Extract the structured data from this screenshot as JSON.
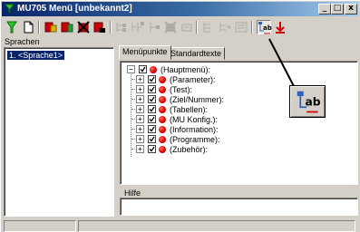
{
  "window": {
    "title": "MU705 Menü [unbekannt2]",
    "minimize": "_",
    "maximize": "□",
    "close": "x"
  },
  "toolbar": {
    "icons": [
      "filter-green-icon",
      "new-document-icon",
      "add-entry-icon",
      "edit-entry-icon",
      "delete-entry-icon",
      "rename-entry-icon",
      "tree-op-1-icon",
      "tree-op-2-icon",
      "tree-op-3-icon",
      "tree-op-4-icon",
      "tree-op-5-icon",
      "tree-op-6-icon",
      "tree-op-7-icon",
      "tree-op-8-icon",
      "rename-text-icon",
      "move-down-red-icon"
    ]
  },
  "languages": {
    "label": "Sprachen",
    "items": [
      "1. <Sprache1>"
    ]
  },
  "tabs": [
    {
      "label": "Menüpunkte",
      "active": true
    },
    {
      "label": "Standardtexte",
      "active": false
    }
  ],
  "tree": {
    "root": "(Hauptmenü):",
    "children": [
      "(Parameter):",
      "(Test):",
      "(Ziel/Nummer):",
      "(Tabellen):",
      "(MU Konfig.):",
      "(Information):",
      "(Programme):",
      "(Zubehör):"
    ]
  },
  "help": {
    "label": "Hilfe",
    "value": ""
  },
  "colors": {
    "title_start": "#0a246a",
    "title_end": "#a6caf0",
    "selection": "#0a246a",
    "dot_red": "#d40000",
    "arrow": "#000000"
  }
}
